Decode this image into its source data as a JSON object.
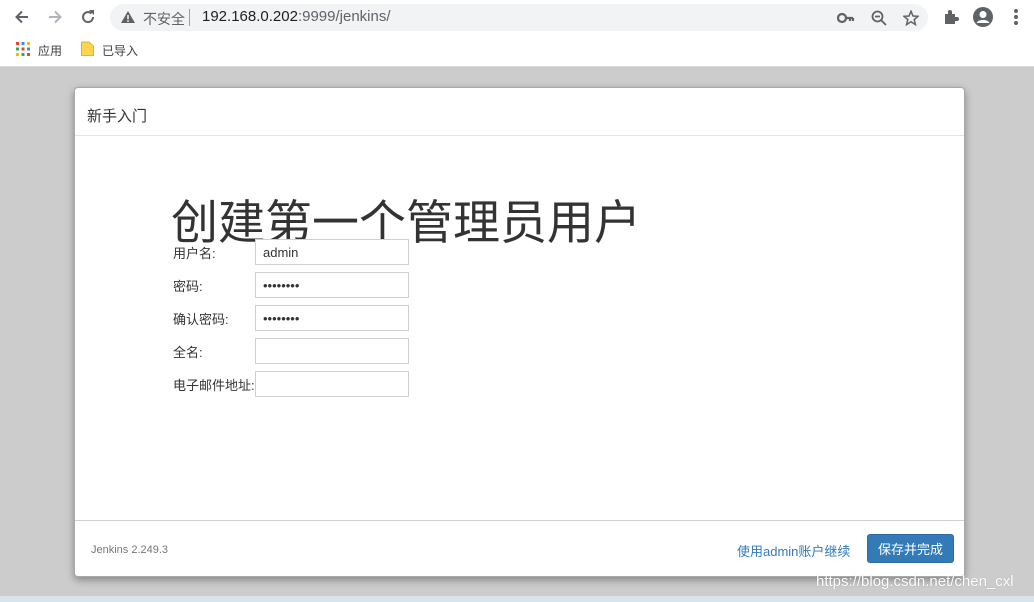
{
  "browser": {
    "back_icon": "arrow-left-icon",
    "forward_icon": "arrow-right-icon",
    "reload_icon": "reload-icon",
    "security_text": "不安全",
    "url_host": "192.168.0.202",
    "url_rest": ":9999/jenkins/",
    "omnibox_icons": [
      "key-icon",
      "zoom-icon",
      "star-icon"
    ],
    "toolbar_icons": [
      "extensions-icon",
      "profile-icon",
      "menu-icon"
    ]
  },
  "bookmarks": {
    "apps_label": "应用",
    "folder_label": "已导入"
  },
  "dialog": {
    "title": "新手入门",
    "heading": "创建第一个管理员用户",
    "fields": [
      {
        "label": "用户名:",
        "value": "admin",
        "type": "text"
      },
      {
        "label": "密码:",
        "value": "password",
        "type": "password"
      },
      {
        "label": "确认密码:",
        "value": "password",
        "type": "password"
      },
      {
        "label": "全名:",
        "value": "",
        "type": "text"
      },
      {
        "label": "电子邮件地址:",
        "value": "",
        "type": "text"
      }
    ],
    "footer": {
      "version": "Jenkins 2.249.3",
      "continue_link": "使用admin账户继续",
      "save_button": "保存并完成"
    }
  },
  "watermark": "https://blog.csdn.net/chen_cxl",
  "colors": {
    "accent": "#337ab7",
    "backdrop": "#cccccc"
  }
}
